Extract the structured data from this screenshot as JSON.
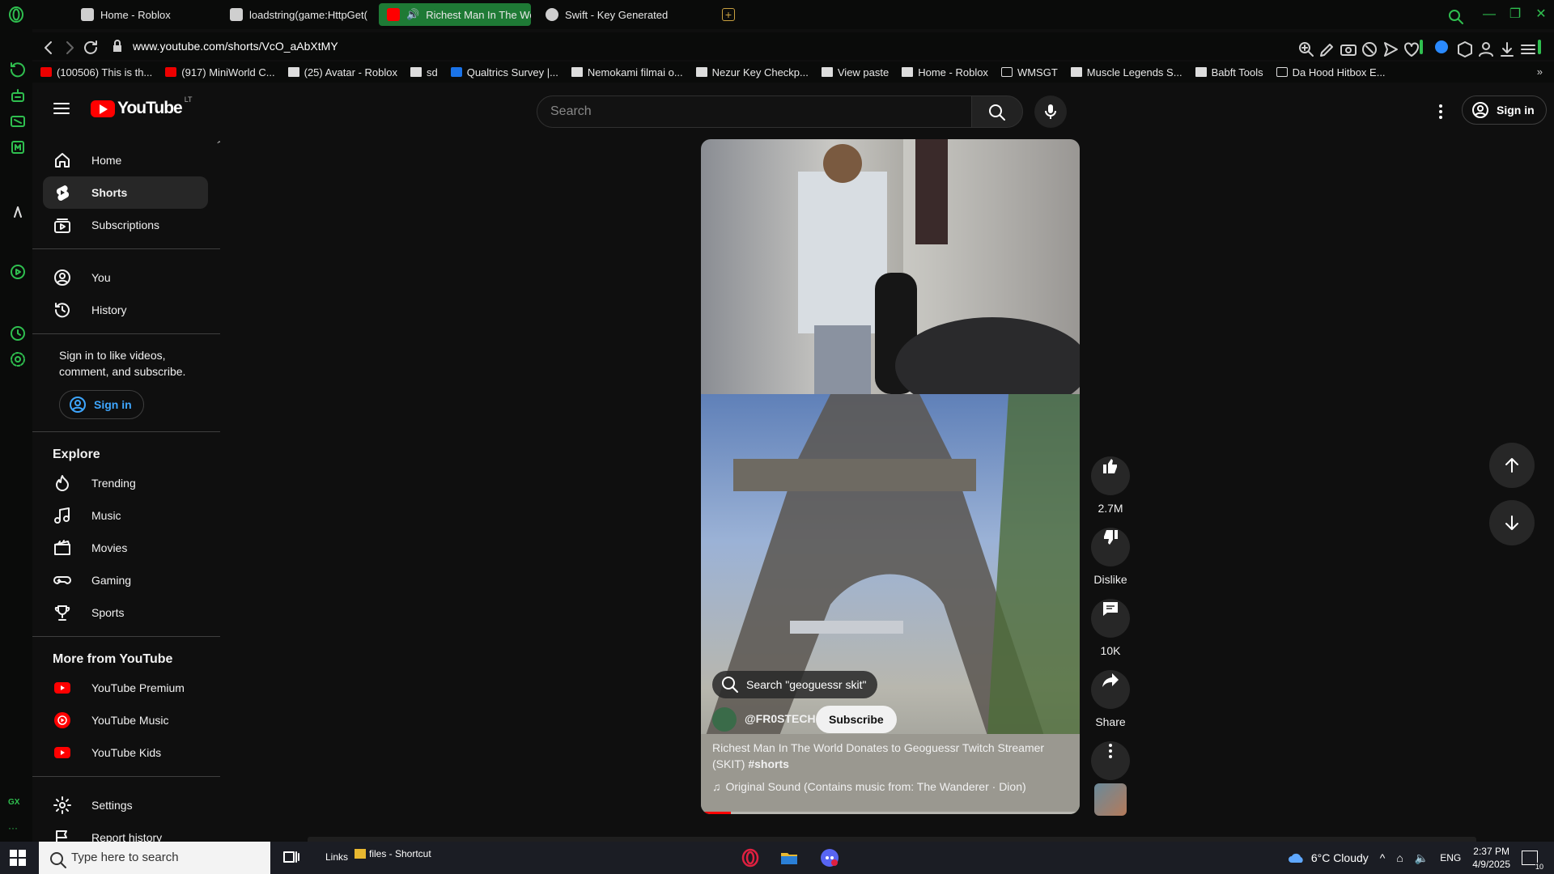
{
  "browser": {
    "tabs": [
      {
        "label": "Home - Roblox",
        "active": false
      },
      {
        "label": "loadstring(game:HttpGet(",
        "active": false
      },
      {
        "label": "Richest Man In The Wo",
        "active": true
      },
      {
        "label": "Swift - Key Generated",
        "active": false
      }
    ],
    "url": "www.youtube.com/shorts/VcO_aAbXtMY",
    "bookmarks": [
      "(100506) This is th...",
      "(917) MiniWorld C...",
      "(25) Avatar - Roblox",
      "sd",
      "Qualtrics Survey |...",
      "Nemokami filmai o...",
      "Nezur Key Checkp...",
      "View paste",
      "Home - Roblox",
      "WMSGT",
      "Muscle Legends S...",
      "Babft Tools",
      "Da Hood Hitbox E..."
    ],
    "accent": "#2fbf4f"
  },
  "youtube": {
    "logo_text": "YouTube",
    "country": "LT",
    "search_placeholder": "Search",
    "sign_in": "Sign in"
  },
  "guide": {
    "main": [
      "Home",
      "Shorts",
      "Subscriptions"
    ],
    "you": [
      "You",
      "History"
    ],
    "sign_msg": "Sign in to like videos, comment, and subscribe.",
    "sign_in": "Sign in",
    "explore_title": "Explore",
    "explore": [
      "Trending",
      "Music",
      "Movies",
      "Gaming",
      "Sports"
    ],
    "more_title": "More from YouTube",
    "more": [
      "YouTube Premium",
      "YouTube Music",
      "YouTube Kids"
    ],
    "settings": "Settings",
    "report": "Report history"
  },
  "short": {
    "search_chip": "Search \"geoguessr skit\"",
    "channel": "@FR0STECH",
    "subscribe": "Subscribe",
    "title": "Richest Man In The World Donates to Geoguessr Twitch Streamer (SKIT)",
    "hashtag": "#shorts",
    "sound": "Original Sound (Contains music from: The Wanderer · Dion)",
    "progress": 0.08
  },
  "actions": {
    "likes": "2.7M",
    "dislike": "Dislike",
    "comments": "10K",
    "share": "Share"
  },
  "taskbar": {
    "search_placeholder": "Type here to search",
    "links": "Links",
    "shortcut": "files - Shortcut",
    "weather": "6°C  Cloudy",
    "lang": "ENG",
    "time": "2:37 PM",
    "date": "4/9/2025",
    "notif": "10"
  }
}
